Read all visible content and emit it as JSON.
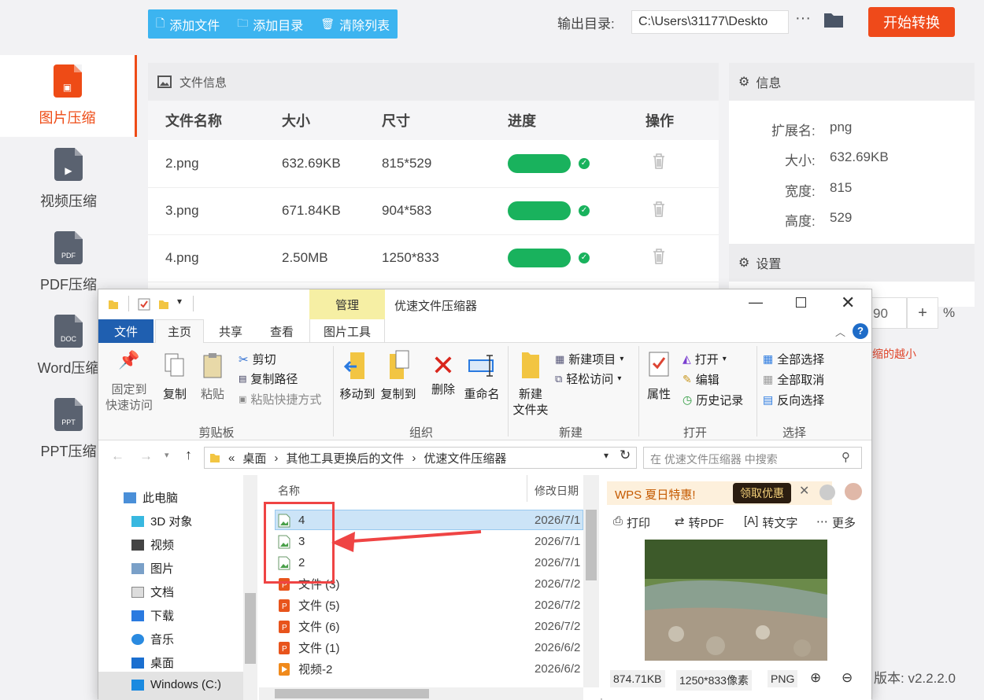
{
  "sidebar": {
    "items": [
      {
        "label": "图片压缩",
        "active": true
      },
      {
        "label": "视频压缩",
        "icon_text": "▶"
      },
      {
        "label": "PDF压缩",
        "icon_text": "PDF"
      },
      {
        "label": "Word压缩",
        "icon_text": "DOC"
      },
      {
        "label": "PPT压缩",
        "icon_text": "PPT"
      }
    ]
  },
  "toolbar": {
    "add_file": "添加文件",
    "add_dir": "添加目录",
    "clear_list": "清除列表",
    "output_label": "输出目录:",
    "output_path": "C:\\Users\\31177\\Deskto",
    "more": "···",
    "start": "开始转换"
  },
  "file_panel": {
    "title": "文件信息",
    "columns": [
      "文件名称",
      "大小",
      "尺寸",
      "进度",
      "操作"
    ],
    "rows": [
      {
        "name": "2.png",
        "size": "632.69KB",
        "dim": "815*529"
      },
      {
        "name": "3.png",
        "size": "671.84KB",
        "dim": "904*583"
      },
      {
        "name": "4.png",
        "size": "2.50MB",
        "dim": "1250*833"
      }
    ]
  },
  "info_panel": {
    "title": "信息",
    "ext_label": "扩展名:",
    "ext": "png",
    "size_label": "大小:",
    "size": "632.69KB",
    "width_label": "宽度:",
    "width": "815",
    "height_label": "高度:",
    "height": "529"
  },
  "settings_panel": {
    "title": "设置",
    "quality": "90",
    "plus": "+",
    "percent": "%",
    "hint": "缩的越小"
  },
  "version": "版本: v2.2.2.0",
  "explorer": {
    "manage_tab": "管理",
    "window_title": "优速文件压缩器",
    "tabs": [
      "文件",
      "主页",
      "共享",
      "查看",
      "图片工具"
    ],
    "ribbon": {
      "pin": [
        "固定到",
        "快速访问"
      ],
      "copy": "复制",
      "paste": "粘贴",
      "cut": "剪切",
      "copy_path": "复制路径",
      "paste_shortcut": "粘贴快捷方式",
      "clipboard_group": "剪贴板",
      "move_to": "移动到",
      "copy_to": "复制到",
      "delete": "删除",
      "rename": "重命名",
      "organize_group": "组织",
      "new_folder": [
        "新建",
        "文件夹"
      ],
      "new_item": "新建项目",
      "easy_access": "轻松访问",
      "new_group": "新建",
      "properties": "属性",
      "open": "打开",
      "edit": "编辑",
      "history": "历史记录",
      "open_group": "打开",
      "select_all": "全部选择",
      "select_none": "全部取消",
      "invert": "反向选择",
      "select_group": "选择"
    },
    "breadcrumb": [
      "桌面",
      "其他工具更换后的文件",
      "优速文件压缩器"
    ],
    "breadcrumb_prefix": "«",
    "search_placeholder": "在 优速文件压缩器 中搜索",
    "nav": [
      "此电脑",
      "3D 对象",
      "视频",
      "图片",
      "文档",
      "下载",
      "音乐",
      "桌面",
      "Windows (C:)"
    ],
    "list_headers": {
      "name": "名称",
      "date": "修改日期"
    },
    "files": [
      {
        "name": "4",
        "date": "2026/7/1",
        "type": "img",
        "selected": true
      },
      {
        "name": "3",
        "date": "2026/7/1",
        "type": "img"
      },
      {
        "name": "2",
        "date": "2026/7/1",
        "type": "img"
      },
      {
        "name": "文件 (3)",
        "date": "2026/7/2",
        "type": "ppt"
      },
      {
        "name": "文件 (5)",
        "date": "2026/7/2",
        "type": "ppt"
      },
      {
        "name": "文件 (6)",
        "date": "2026/7/2",
        "type": "ppt"
      },
      {
        "name": "文件 (1)",
        "date": "2026/6/2",
        "type": "ppt"
      },
      {
        "name": "视频-2",
        "date": "2026/6/2",
        "type": "video"
      }
    ],
    "preview": {
      "ad_text": "WPS 夏日特惠!",
      "ad_button": "领取优惠",
      "print": "打印",
      "to_pdf": "转PDF",
      "to_text": "转文字",
      "more": "更多",
      "file_size": "874.71KB",
      "dims": "1250*833像素",
      "format": "PNG"
    }
  }
}
